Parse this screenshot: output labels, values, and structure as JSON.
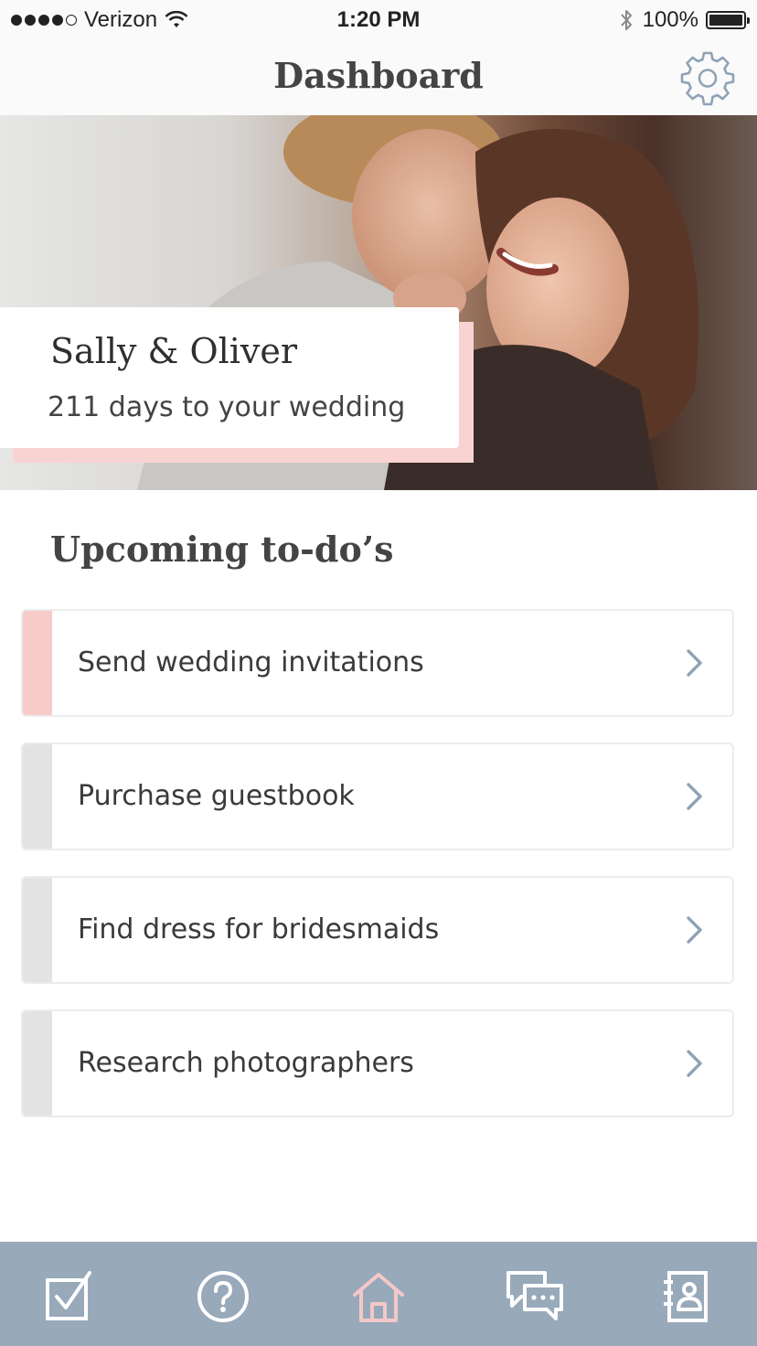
{
  "status_bar": {
    "carrier": "Verizon",
    "time": "1:20 PM",
    "battery": "100%"
  },
  "nav": {
    "title": "Dashboard",
    "settings_icon": "gear-icon"
  },
  "hero": {
    "photo": "couple-kissing-photo",
    "couple_names": "Sally & Oliver",
    "countdown": "211 days to your wedding"
  },
  "todos": {
    "title": "Upcoming to-do’s",
    "items": [
      {
        "label": "Send wedding invitations",
        "accent": "#f8caca"
      },
      {
        "label": "Purchase guestbook",
        "accent": "#e3e3e3"
      },
      {
        "label": "Find dress for bridesmaids",
        "accent": "#e3e3e3"
      },
      {
        "label": "Research photographers",
        "accent": "#e3e3e3"
      }
    ]
  },
  "tab_bar": {
    "background": "#98a9ba",
    "active_color": "#f4c8c8",
    "icons": [
      "checklist-icon",
      "help-icon",
      "home-icon",
      "messages-icon",
      "contacts-icon"
    ],
    "active_index": 2
  }
}
